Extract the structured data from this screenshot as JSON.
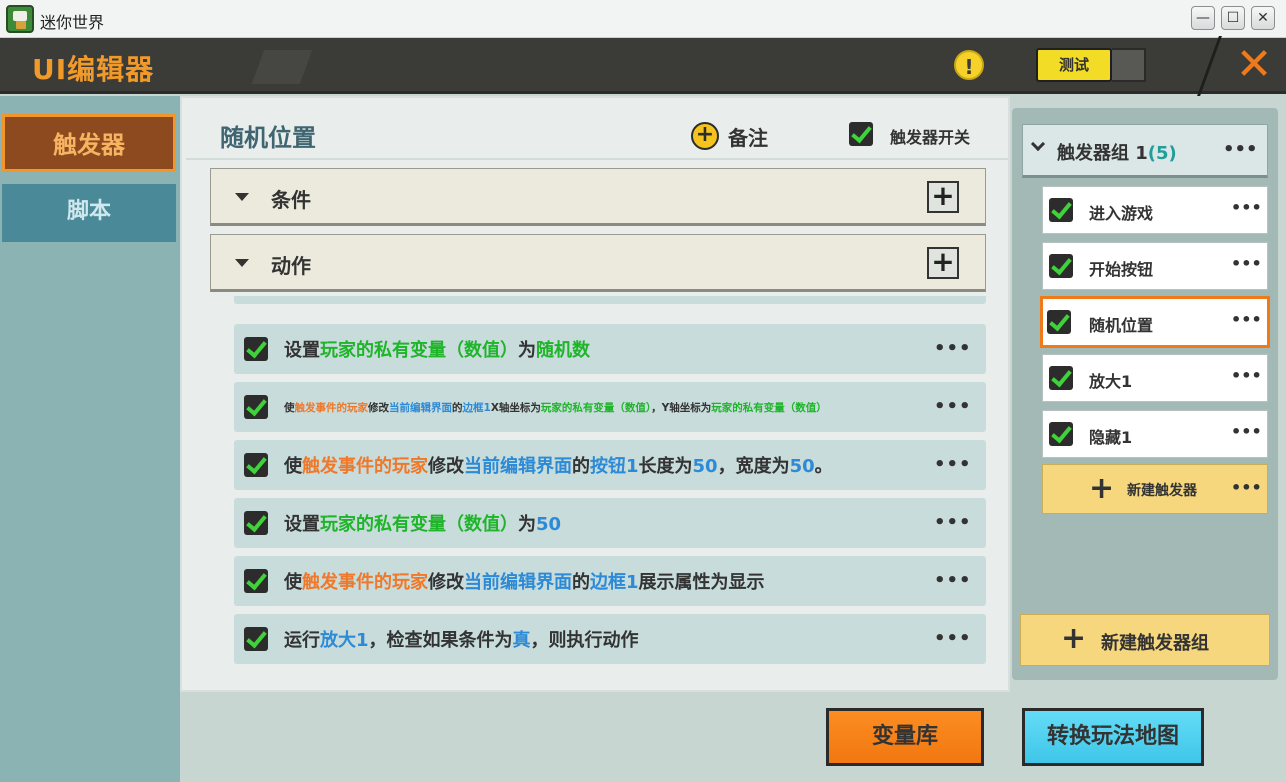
{
  "window": {
    "title": "迷你世界",
    "min": "—",
    "max": "☐",
    "close": "✕"
  },
  "header": {
    "title": "UI编辑器",
    "warn": "!",
    "test_label": "测试",
    "close": "✕"
  },
  "sidebar": {
    "tabs": [
      {
        "label": "触发器"
      },
      {
        "label": "脚本"
      }
    ]
  },
  "main": {
    "title": "随机位置",
    "note_icon": "+",
    "note_label": "备注",
    "switch_label": "触发器开关",
    "sections": [
      {
        "label": "条件",
        "add": "+"
      },
      {
        "label": "动作",
        "add": "+"
      }
    ],
    "actions": [
      {
        "parts": [
          {
            "t": "设置"
          },
          {
            "t": "玩家的私有变量（数值）",
            "c": "g"
          },
          {
            "t": "为"
          },
          {
            "t": "随机数",
            "c": "g"
          }
        ]
      },
      {
        "parts": [
          {
            "t": "使"
          },
          {
            "t": "触发事件的玩家",
            "c": "o"
          },
          {
            "t": "修改"
          },
          {
            "t": "当前编辑界面",
            "c": "b"
          },
          {
            "t": "的"
          },
          {
            "t": "边框1",
            "c": "b"
          },
          {
            "t": "X轴坐标为"
          },
          {
            "t": "玩家的私有变量（数值）",
            "c": "g"
          },
          {
            "t": "，Y轴坐标为"
          },
          {
            "t": "玩家的私有变量（数值）",
            "c": "g"
          }
        ]
      },
      {
        "parts": [
          {
            "t": "使"
          },
          {
            "t": "触发事件的玩家",
            "c": "o"
          },
          {
            "t": "修改"
          },
          {
            "t": "当前编辑界面",
            "c": "b"
          },
          {
            "t": "的"
          },
          {
            "t": "按钮1",
            "c": "b"
          },
          {
            "t": "长度为"
          },
          {
            "t": "50",
            "c": "b"
          },
          {
            "t": "，宽度为"
          },
          {
            "t": "50",
            "c": "b"
          },
          {
            "t": "。"
          }
        ]
      },
      {
        "parts": [
          {
            "t": "设置"
          },
          {
            "t": "玩家的私有变量（数值）",
            "c": "g"
          },
          {
            "t": "为"
          },
          {
            "t": "50",
            "c": "b"
          }
        ]
      },
      {
        "parts": [
          {
            "t": "使"
          },
          {
            "t": "触发事件的玩家",
            "c": "o"
          },
          {
            "t": "修改"
          },
          {
            "t": "当前编辑界面",
            "c": "b"
          },
          {
            "t": "的"
          },
          {
            "t": "边框1",
            "c": "b"
          },
          {
            "t": "展示属性为显示"
          }
        ]
      },
      {
        "parts": [
          {
            "t": "运行"
          },
          {
            "t": "放大1",
            "c": "b"
          },
          {
            "t": "，检查如果条件为"
          },
          {
            "t": "真",
            "c": "b"
          },
          {
            "t": "，则执行动作"
          }
        ]
      }
    ],
    "more": "•••"
  },
  "right": {
    "group": {
      "label": "触发器组 1",
      "count": "(5)",
      "more": "•••"
    },
    "triggers": [
      {
        "label": "进入游戏"
      },
      {
        "label": "开始按钮"
      },
      {
        "label": "随机位置"
      },
      {
        "label": "放大1"
      },
      {
        "label": "隐藏1"
      }
    ],
    "trigger_more": "•••",
    "new_trigger": {
      "plus": "+",
      "label": "新建触发器",
      "more": "•••"
    },
    "new_group": {
      "plus": "+",
      "label": "新建触发器组"
    }
  },
  "bottom": {
    "var_label": "变量库",
    "map_label": "转换玩法地图"
  },
  "colors": {
    "accent_orange": "#f07a1a",
    "green_text": "#1fb42a",
    "blue_text": "#2d8ad6",
    "orange_text": "#f0782a"
  }
}
